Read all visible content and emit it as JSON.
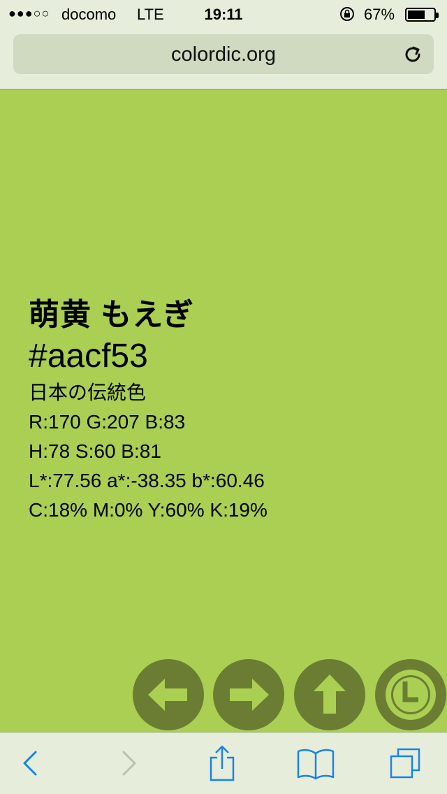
{
  "status_bar": {
    "signal": "●●●○○",
    "carrier": "docomo",
    "network": "LTE",
    "time": "19:11",
    "battery_percent": "67%",
    "battery_level": 0.67
  },
  "url_bar": {
    "url": "colordic.org"
  },
  "color": {
    "name": "萌黄 もえぎ",
    "hex": "#aacf53",
    "category": "日本の伝統色",
    "rgb": "R:170 G:207 B:83",
    "hsb": "H:78 S:60 B:81",
    "lab": "L*:77.56 a*:-38.35 b*:60.46",
    "cmyk": "C:18% M:0% Y:60% K:19%"
  },
  "nav_buttons": [
    {
      "icon": "arrow-left-icon"
    },
    {
      "icon": "arrow-right-icon"
    },
    {
      "icon": "arrow-up-icon"
    },
    {
      "icon": "clock-icon"
    }
  ],
  "toolbar": {
    "items": [
      "back-icon",
      "forward-icon",
      "share-icon",
      "bookmarks-icon",
      "tabs-icon"
    ]
  },
  "colors": {
    "page_background": "#aacf53",
    "chrome": "#e6eedb",
    "button": "#6b7d33",
    "ios_blue": "#1a82e8"
  }
}
